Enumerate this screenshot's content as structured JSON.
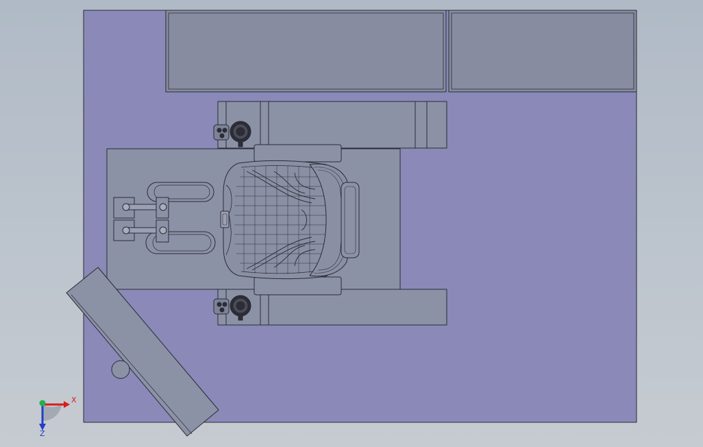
{
  "window": {
    "title": ""
  },
  "viewport": {
    "background_top": "#b0bac6",
    "background_bottom": "#c6cbd1",
    "model": {
      "floor_color": "#8a89b8",
      "part_color": "#8c92a6",
      "dark_part_color": "#848a9c",
      "edge_color": "#2a2a36"
    }
  },
  "triad": {
    "x_label": "X",
    "z_label": "Z",
    "x_color": "#d81c1c",
    "y_color": "#22b14c",
    "z_color": "#2040c8"
  }
}
